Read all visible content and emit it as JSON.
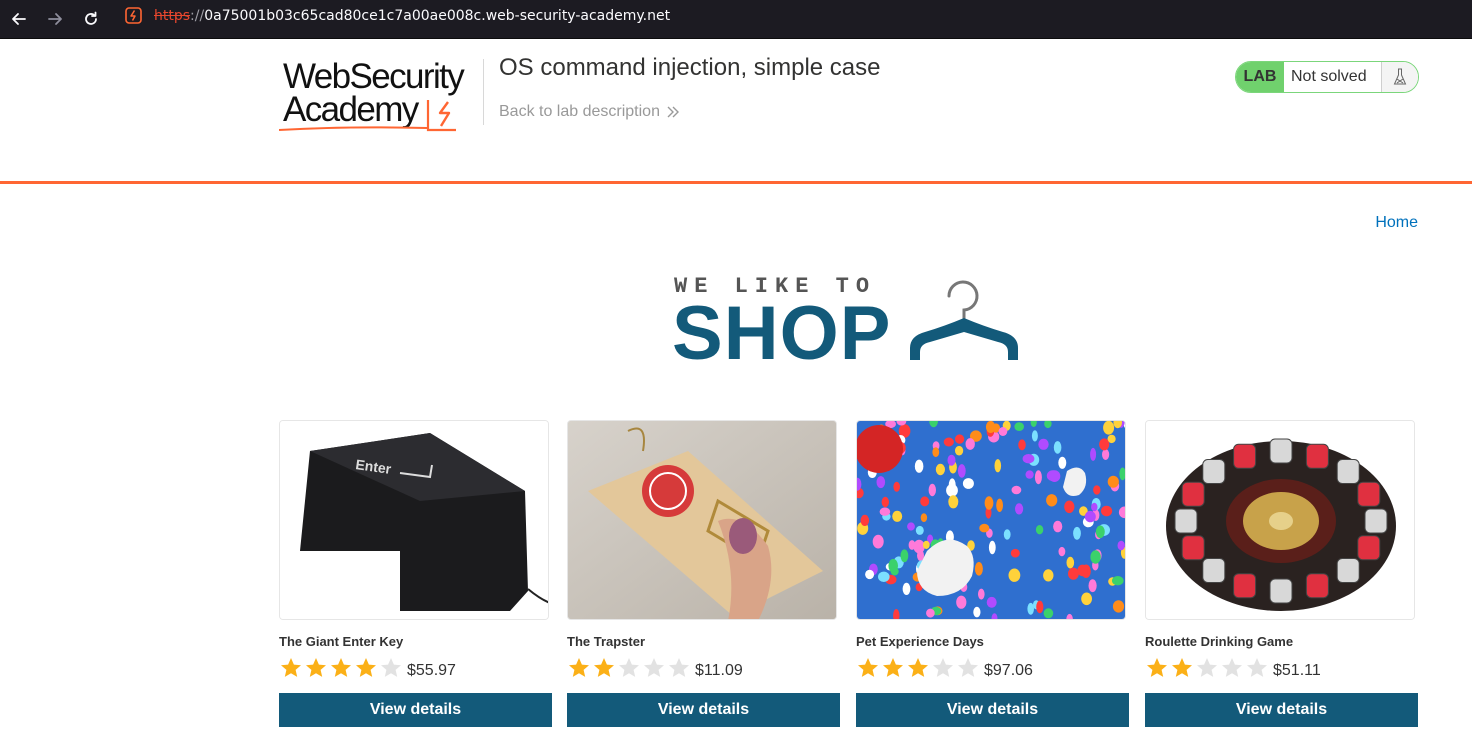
{
  "browser": {
    "url_scheme": "https",
    "url_sep": "://",
    "url_host": "0a75001b03c65cad80ce1c7a00ae008c.web-security-academy.net"
  },
  "academy": {
    "logo_line1": "WebSecurity",
    "logo_line2": "Academy",
    "lab_title": "OS command injection, simple case",
    "back_link": "Back to lab description",
    "lab_badge": "LAB",
    "lab_state": "Not solved",
    "accent_color": "#ff6633"
  },
  "shop": {
    "home_link": "Home",
    "banner_top": "WE LIKE TO",
    "banner_main": "SHOP",
    "products": [
      {
        "name": "The Giant Enter Key",
        "rating": 4,
        "price": "$55.97",
        "button": "View details"
      },
      {
        "name": "The Trapster",
        "rating": 2,
        "price": "$11.09",
        "button": "View details"
      },
      {
        "name": "Pet Experience Days",
        "rating": 3,
        "price": "$97.06",
        "button": "View details"
      },
      {
        "name": "Roulette Drinking Game",
        "rating": 2,
        "price": "$51.11",
        "button": "View details"
      }
    ]
  }
}
